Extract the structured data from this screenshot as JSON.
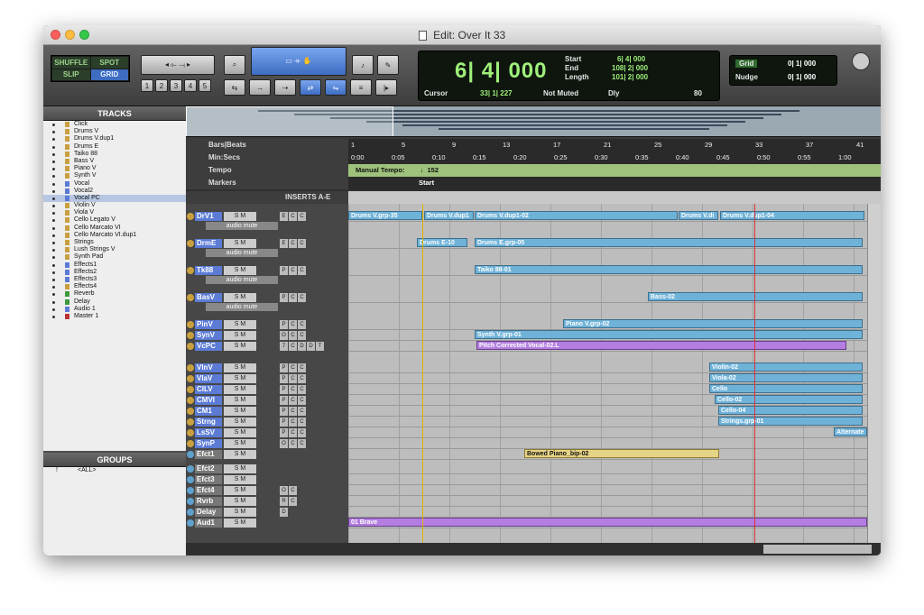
{
  "window": {
    "title": "Edit: Over It 33"
  },
  "modes": {
    "shuffle": "SHUFFLE",
    "spot": "SPOT",
    "slip": "SLIP",
    "grid": "GRID"
  },
  "zoom_presets": [
    "1",
    "2",
    "3",
    "4",
    "5"
  ],
  "counter": {
    "main": "6| 4| 000",
    "start_label": "Start",
    "start_value": "6| 4| 000",
    "end_label": "End",
    "end_value": "108| 2| 000",
    "length_label": "Length",
    "length_value": "101| 2| 000",
    "cursor_label": "Cursor",
    "cursor_value": "33| 1| 227",
    "not_muted": "Not Muted",
    "dly_label": "Dly",
    "tempo_value": "80"
  },
  "grid": {
    "grid_label": "Grid",
    "grid_value": "0| 1| 000",
    "nudge_label": "Nudge",
    "nudge_value": "0| 1| 000"
  },
  "tracks_panel": {
    "title": "TRACKS",
    "items": [
      {
        "name": "Click",
        "sel": false
      },
      {
        "name": "Drums V",
        "sel": false
      },
      {
        "name": "Drums V.dup1",
        "sel": false
      },
      {
        "name": "Drums E",
        "sel": false
      },
      {
        "name": "Taiko 88",
        "sel": false
      },
      {
        "name": "Bass V",
        "sel": false
      },
      {
        "name": "Piano V",
        "sel": false
      },
      {
        "name": "Synth V",
        "sel": false
      },
      {
        "name": "Vocal",
        "sel": false
      },
      {
        "name": "Vocal2",
        "sel": false
      },
      {
        "name": "Vocal PC",
        "sel": true
      },
      {
        "name": "Violin V",
        "sel": false
      },
      {
        "name": "Viola V",
        "sel": false
      },
      {
        "name": "Cello Legato V",
        "sel": false
      },
      {
        "name": "Cello Marcato VI",
        "sel": false
      },
      {
        "name": "Cello Marcato VI.dup1",
        "sel": false
      },
      {
        "name": "Strings",
        "sel": false
      },
      {
        "name": "Lush Strings V",
        "sel": false
      },
      {
        "name": "Synth Pad",
        "sel": false
      },
      {
        "name": "Effects1",
        "sel": false
      },
      {
        "name": "Effects2",
        "sel": false
      },
      {
        "name": "Effects3",
        "sel": false
      },
      {
        "name": "Effects4",
        "sel": false
      },
      {
        "name": "Reverb",
        "sel": false
      },
      {
        "name": "Delay",
        "sel": false
      },
      {
        "name": "Audio 1",
        "sel": false
      },
      {
        "name": "Master 1",
        "sel": false
      }
    ]
  },
  "groups_panel": {
    "title": "GROUPS",
    "all_label": "<ALL>",
    "all_id": "!"
  },
  "rulers": {
    "bars_label": "Bars|Beats",
    "minsecs_label": "Min:Secs",
    "tempo_label": "Tempo",
    "markers_label": "Markers",
    "bars": [
      "1",
      "5",
      "9",
      "13",
      "17",
      "21",
      "25",
      "29",
      "33",
      "37",
      "41"
    ],
    "secs": [
      "0:00",
      "0:05",
      "0:10",
      "0:15",
      "0:20",
      "0:25",
      "0:30",
      "0:35",
      "0:40",
      "0:45",
      "0:50",
      "0:55",
      "1:00"
    ],
    "tempo_text": "Manual Tempo:",
    "tempo_val": "♩152",
    "marker_start": "Start"
  },
  "inserts_label": "INSERTS A-E",
  "audio_mute": "audio mute",
  "track_headers": [
    {
      "name": "DrV1",
      "sm": "S M",
      "inserts": [
        "E",
        "C",
        "C"
      ],
      "aux": false
    },
    {
      "name": "DrmE",
      "sm": "S M",
      "inserts": [
        "E",
        "C",
        "C"
      ],
      "aux": false
    },
    {
      "name": "Tk88",
      "sm": "S M",
      "inserts": [
        "P",
        "C",
        "C"
      ],
      "aux": false
    },
    {
      "name": "BasV",
      "sm": "S M",
      "inserts": [
        "P",
        "C",
        "C"
      ],
      "aux": false
    },
    {
      "name": "PinV",
      "sm": "S M",
      "inserts": [
        "P",
        "C",
        "C"
      ],
      "aux": false
    },
    {
      "name": "SynV",
      "sm": "S M",
      "inserts": [
        "O",
        "C",
        "C"
      ],
      "aux": false
    },
    {
      "name": "VcPC",
      "sm": "S M",
      "inserts": [
        "7",
        "C",
        "D",
        "D",
        "T"
      ],
      "aux": false
    },
    {
      "name": "VlnV",
      "sm": "S M",
      "inserts": [
        "P",
        "C",
        "C"
      ],
      "aux": false
    },
    {
      "name": "VlaV",
      "sm": "S M",
      "inserts": [
        "P",
        "C",
        "C"
      ],
      "aux": false
    },
    {
      "name": "ClLV",
      "sm": "S M",
      "inserts": [
        "P",
        "C",
        "C"
      ],
      "aux": false
    },
    {
      "name": "CMVI",
      "sm": "S M",
      "inserts": [
        "P",
        "C",
        "C"
      ],
      "aux": false
    },
    {
      "name": "CM1",
      "sm": "S M",
      "inserts": [
        "P",
        "C",
        "C"
      ],
      "aux": false
    },
    {
      "name": "Strng",
      "sm": "S M",
      "inserts": [
        "P",
        "C",
        "C"
      ],
      "aux": false
    },
    {
      "name": "LsSV",
      "sm": "S M",
      "inserts": [
        "P",
        "C",
        "C"
      ],
      "aux": false
    },
    {
      "name": "SynP",
      "sm": "S M",
      "inserts": [
        "O",
        "C",
        "C"
      ],
      "aux": false
    },
    {
      "name": "Efct1",
      "sm": "S M",
      "inserts": [],
      "aux": true
    },
    {
      "name": "Efct2",
      "sm": "S M",
      "inserts": [],
      "aux": true
    },
    {
      "name": "Efct3",
      "sm": "S M",
      "inserts": [],
      "aux": true
    },
    {
      "name": "Efct4",
      "sm": "S M",
      "inserts": [
        "O",
        "C"
      ],
      "aux": true
    },
    {
      "name": "Rvrb",
      "sm": "S M",
      "inserts": [
        "R",
        "C"
      ],
      "aux": true
    },
    {
      "name": "Delay",
      "sm": "S M",
      "inserts": [
        "D"
      ],
      "aux": true
    },
    {
      "name": "Aud1",
      "sm": "S M",
      "inserts": [],
      "aux": true
    }
  ],
  "clips": [
    {
      "label": "Drums V.grp-35",
      "color": "blue"
    },
    {
      "label": "Drums V.dup1",
      "color": "blue"
    },
    {
      "label": "Drums V.dup1-02",
      "color": "blue"
    },
    {
      "label": "Drums V.di",
      "color": "blue"
    },
    {
      "label": "Drums V.dup1-04",
      "color": "blue"
    },
    {
      "label": "Drums E-10",
      "color": "blue"
    },
    {
      "label": "Drums E.grp-05",
      "color": "blue"
    },
    {
      "label": "Taiko 88-01",
      "color": "blue"
    },
    {
      "label": "Bass-02",
      "color": "blue"
    },
    {
      "label": "Piano V.grp-02",
      "color": "blue"
    },
    {
      "label": "Synth V.grp-01",
      "color": "blue"
    },
    {
      "label": "Pitch Corrected Vocal-02.L",
      "color": "purple"
    },
    {
      "label": "Violin-02",
      "color": "blue"
    },
    {
      "label": "Viola-02",
      "color": "blue"
    },
    {
      "label": "Cello",
      "color": "blue"
    },
    {
      "label": "Cello-02",
      "color": "blue"
    },
    {
      "label": "Cello-04",
      "color": "blue"
    },
    {
      "label": "Strings.grp-01",
      "color": "blue"
    },
    {
      "label": "Alternate",
      "color": "blue"
    },
    {
      "label": "Bowed Piano_bip-02",
      "color": "yellow"
    },
    {
      "label": "01 Brave",
      "color": "purple"
    }
  ],
  "colors": {
    "selection": "#3d6cc1",
    "counter_green": "#9ff07a",
    "clip_blue": "#6fb2d8",
    "clip_purple": "#b37ee0",
    "tempo_ruler": "#9ec27b"
  }
}
